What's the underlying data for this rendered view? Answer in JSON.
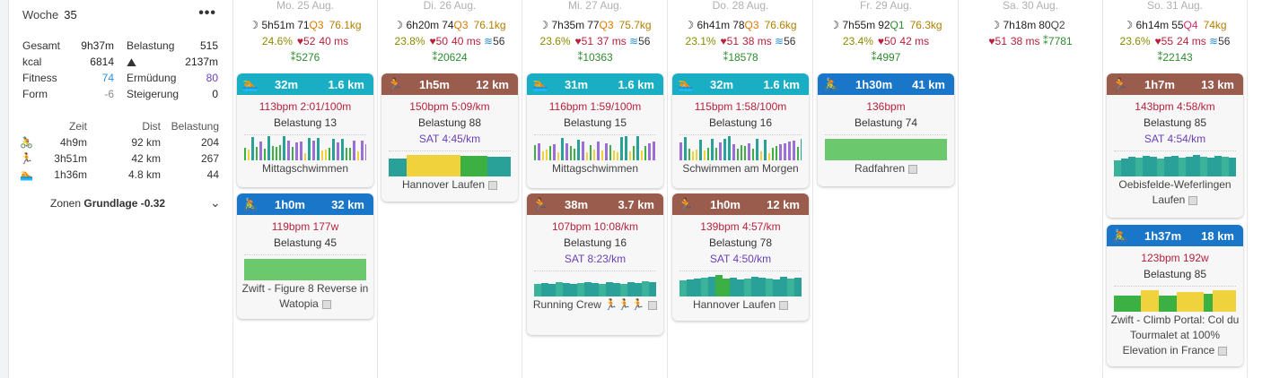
{
  "week": {
    "label": "Woche",
    "number": "35",
    "menu_icon": "more-dots",
    "stats": [
      {
        "l1": "Gesamt",
        "v1": "9h37m",
        "l2": "Belastung",
        "v2": "515"
      },
      {
        "l1": "kcal",
        "v1": "6814",
        "l2": "mountain",
        "v2": "2137m"
      },
      {
        "l1": "Fitness",
        "v1": "74",
        "l2": "Ermüdung",
        "v2": "80"
      },
      {
        "l1": "Form",
        "v1": "-6",
        "l2": "Steigerung",
        "v2": "0"
      }
    ],
    "sport_headers": {
      "zeit": "Zeit",
      "dist": "Dist",
      "bel": "Belastung"
    },
    "sports": [
      {
        "icon": "bike-icon",
        "zeit": "4h9m",
        "dist": "92 km",
        "bel": "204"
      },
      {
        "icon": "run-icon",
        "zeit": "3h51m",
        "dist": "42 km",
        "bel": "267"
      },
      {
        "icon": "swim-icon",
        "zeit": "1h36m",
        "dist": "4.8 km",
        "bel": "44"
      }
    ],
    "zonen_label": "Zonen",
    "zonen_value": "Grundlage -0.32"
  },
  "days": [
    {
      "name": "Mo. 25 Aug.",
      "r1": {
        "sleep": "5h51m",
        "score": "71",
        "q": "Q3",
        "qclass": "q3",
        "kg": "76.1kg"
      },
      "r2": {
        "pct": "24.6%",
        "hr": "52",
        "hrv": "40 ms",
        "swim": ""
      },
      "r3": {
        "steps": "5276"
      },
      "cards": [
        {
          "type": "swim",
          "dur": "32m",
          "dist": "1.6 km",
          "l1": "113bpm 2:01/100m",
          "bel": "Belastung 13",
          "sat": "",
          "name": "Mittagschwimmen",
          "map": false,
          "chart": "swim1"
        },
        {
          "type": "bike",
          "dur": "1h0m",
          "dist": "32 km",
          "l1": "119bpm 177w",
          "bel": "Belastung 45",
          "sat": "",
          "name": "Zwift - Figure 8 Reverse in Watopia",
          "map": true,
          "chart": "green"
        }
      ]
    },
    {
      "name": "Di. 26 Aug.",
      "r1": {
        "sleep": "6h20m",
        "score": "74",
        "q": "Q3",
        "qclass": "q3",
        "kg": "76.1kg"
      },
      "r2": {
        "pct": "23.8%",
        "hr": "50",
        "hrv": "40 ms",
        "swim": "56"
      },
      "r3": {
        "steps": "20624"
      },
      "cards": [
        {
          "type": "run",
          "dur": "1h5m",
          "dist": "12 km",
          "l1": "150bpm 5:09/km",
          "bel": "Belastung 88",
          "sat": "SAT 4:45/km",
          "name": "Hannover Laufen",
          "map": true,
          "chart": "run_yellow"
        }
      ]
    },
    {
      "name": "Mi. 27 Aug.",
      "r1": {
        "sleep": "7h35m",
        "score": "77",
        "q": "Q3",
        "qclass": "q3",
        "kg": "75.7kg"
      },
      "r2": {
        "pct": "23.6%",
        "hr": "51",
        "hrv": "37 ms",
        "swim": "56"
      },
      "r3": {
        "steps": "10363"
      },
      "cards": [
        {
          "type": "swim",
          "dur": "31m",
          "dist": "1.6 km",
          "l1": "116bpm 1:59/100m",
          "bel": "Belastung 15",
          "sat": "",
          "name": "Mittagschwimmen",
          "map": false,
          "chart": "swim2"
        },
        {
          "type": "run",
          "dur": "38m",
          "dist": "3.7 km",
          "l1": "107bpm 10:08/km",
          "bel": "Belastung 16",
          "sat": "SAT 8:23/km",
          "name": "Running Crew 🏃🏃🏃",
          "map": true,
          "chart": "teal"
        }
      ]
    },
    {
      "name": "Do. 28 Aug.",
      "r1": {
        "sleep": "6h41m",
        "score": "78",
        "q": "Q3",
        "qclass": "q3",
        "kg": "76.6kg"
      },
      "r2": {
        "pct": "23.1%",
        "hr": "51",
        "hrv": "38 ms",
        "swim": "56"
      },
      "r3": {
        "steps": "18578"
      },
      "cards": [
        {
          "type": "swim",
          "dur": "32m",
          "dist": "1.6 km",
          "l1": "115bpm 1:58/100m",
          "bel": "Belastung 16",
          "sat": "",
          "name": "Schwimmen am Morgen",
          "map": false,
          "chart": "swim3"
        },
        {
          "type": "run",
          "dur": "1h0m",
          "dist": "12 km",
          "l1": "139bpm 4:57/km",
          "bel": "Belastung 78",
          "sat": "SAT 4:50/km",
          "name": "Hannover Laufen",
          "map": true,
          "chart": "teal2"
        }
      ]
    },
    {
      "name": "Fr. 29 Aug.",
      "r1": {
        "sleep": "7h55m",
        "score": "92",
        "q": "Q1",
        "qclass": "q1",
        "kg": "76.3kg"
      },
      "r2": {
        "pct": "23.4%",
        "hr": "50",
        "hrv": "42 ms",
        "swim": ""
      },
      "r3": {
        "steps": "4997"
      },
      "cards": [
        {
          "type": "bike",
          "dur": "1h30m",
          "dist": "41 km",
          "l1": "136bpm",
          "bel": "Belastung 74",
          "sat": "",
          "name": "Radfahren",
          "map": true,
          "chart": "green"
        }
      ]
    },
    {
      "name": "Sa. 30 Aug.",
      "r1": {
        "sleep": "7h18m",
        "score": "80",
        "q": "Q2",
        "qclass": "q2",
        "kg": ""
      },
      "r2": {
        "pct": "",
        "hr": "51",
        "hrv": "38 ms",
        "swim": "",
        "steps_inline": "7781"
      },
      "r3": {
        "steps": ""
      },
      "cards": []
    },
    {
      "name": "So. 31 Aug.",
      "r1": {
        "sleep": "6h14m",
        "score": "55",
        "q": "Q4",
        "qclass": "q4",
        "kg": "74kg"
      },
      "r2": {
        "pct": "23.6%",
        "hr": "55",
        "hrv": "24 ms",
        "swim": "56"
      },
      "r3": {
        "steps": "22143"
      },
      "cards": [
        {
          "type": "run",
          "dur": "1h7m",
          "dist": "13 km",
          "l1": "143bpm 4:58/km",
          "bel": "Belastung 85",
          "sat": "SAT 4:54/km",
          "name": "Oebisfelde-Weferlingen Laufen",
          "map": true,
          "chart": "teal3"
        },
        {
          "type": "bike",
          "dur": "1h37m",
          "dist": "18 km",
          "l1": "123bpm 192w",
          "bel": "Belastung 85",
          "sat": "",
          "name": "Zwift - Climb Portal: Col du Tourmalet at 100% Elevation in France",
          "map": true,
          "chart": "bike_yellow"
        }
      ]
    }
  ],
  "colors": {
    "swim": "#1aaec4",
    "run": "#9a5c4d",
    "bike": "#1976c9",
    "heart": "#b8203c",
    "green": "#2e8b2e",
    "purple": "#6b3fb8"
  }
}
